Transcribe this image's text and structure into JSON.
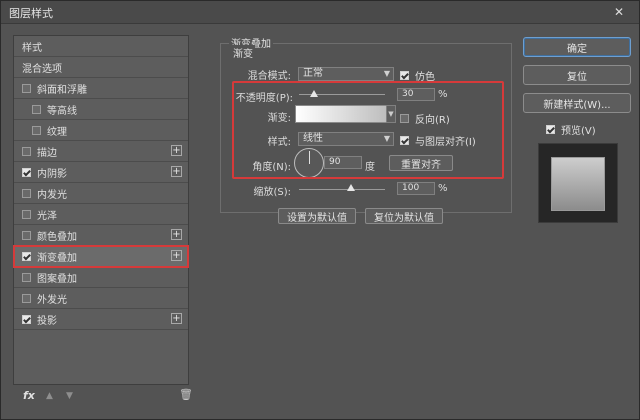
{
  "window": {
    "title": "图层样式"
  },
  "left_panel": {
    "header": "样式",
    "blend_options": "混合选项",
    "items": [
      {
        "label": "斜面和浮雕",
        "checked": false,
        "plus": false
      },
      {
        "label": "等高线",
        "checked": false,
        "plus": false
      },
      {
        "label": "纹理",
        "checked": false,
        "plus": false
      },
      {
        "label": "描边",
        "checked": false,
        "plus": true
      },
      {
        "label": "内阴影",
        "checked": true,
        "plus": true
      },
      {
        "label": "内发光",
        "checked": false,
        "plus": false
      },
      {
        "label": "光泽",
        "checked": false,
        "plus": false
      },
      {
        "label": "颜色叠加",
        "checked": false,
        "plus": true
      },
      {
        "label": "渐变叠加",
        "checked": true,
        "plus": true
      },
      {
        "label": "图案叠加",
        "checked": false,
        "plus": false
      },
      {
        "label": "外发光",
        "checked": false,
        "plus": false
      },
      {
        "label": "投影",
        "checked": true,
        "plus": true
      }
    ],
    "footer": {
      "fx_label": "fx"
    }
  },
  "gradient_overlay": {
    "section_title": "渐变叠加",
    "subsection_title": "渐变",
    "blend_mode_label": "混合模式:",
    "blend_mode_value": "正常",
    "dither_label": "仿色",
    "opacity_label": "不透明度(P):",
    "opacity_value": "30",
    "opacity_unit": "%",
    "opacity_level_pct": 30,
    "gradient_label": "渐变:",
    "reverse_label": "反向(R)",
    "style_label": "样式:",
    "style_value": "线性",
    "align_label": "与图层对齐(I)",
    "angle_label": "角度(N):",
    "angle_value": "90",
    "angle_unit": "度",
    "reset_align_label": "重置对齐",
    "scale_label": "缩放(S):",
    "scale_value": "100",
    "scale_unit": "%",
    "scale_level_pct": 100,
    "set_default_label": "设置为默认值",
    "reset_default_label": "复位为默认值"
  },
  "right_panel": {
    "ok_label": "确定",
    "reset_label": "复位",
    "new_style_label": "新建样式(W)...",
    "preview_label": "预览(V)"
  },
  "colors": {
    "highlight": "#d63a3a",
    "panel_bg": "#535353",
    "primary_border": "#6e9fd0"
  }
}
